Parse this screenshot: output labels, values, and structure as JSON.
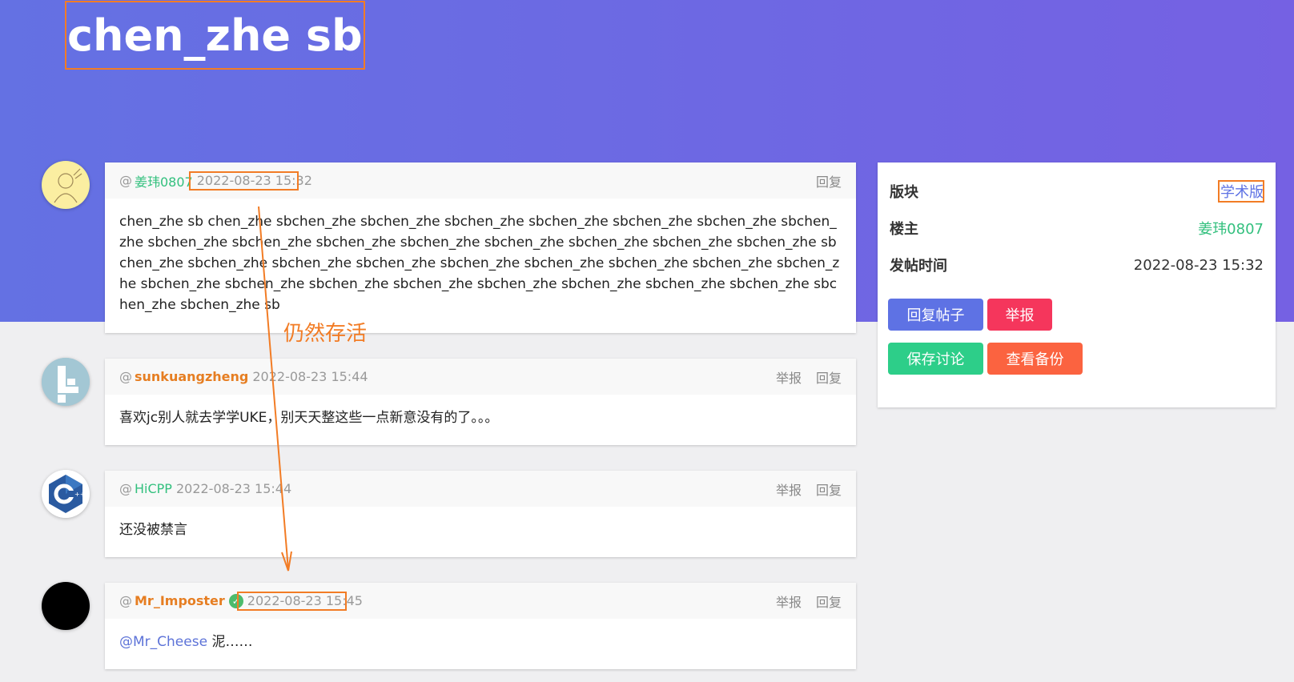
{
  "thread": {
    "title": "chen_zhe sb"
  },
  "posts": [
    {
      "at": "@",
      "user": "姜玮0807",
      "time": "2022-08-23 15:32",
      "actions": [
        "回复"
      ],
      "content": "chen_zhe sb chen_zhe sbchen_zhe sbchen_zhe sbchen_zhe sbchen_zhe sbchen_zhe sbchen_zhe sbchen_zhe sbchen_zhe sbchen_zhe sbchen_zhe sbchen_zhe sbchen_zhe sbchen_zhe sbchen_zhe sbchen_zhe sbchen_zhe sbchen_zhe sbchen_zhe sbchen_zhe sbchen_zhe sbchen_zhe sbchen_zhe sbchen_zhe sbchen_zhe sbchen_zhe sbchen_zhe sbchen_zhe sbchen_zhe sbchen_zhe sbchen_zhe sbchen_zhe sbchen_zhe sbchen_zhe sbchen_zhe sb"
    },
    {
      "at": "@",
      "user": "sunkuangzheng",
      "time": "2022-08-23 15:44",
      "actions": [
        "举报",
        "回复"
      ],
      "content": "喜欢jc别人就去学学UKE，别天天整这些一点新意没有的了。。。"
    },
    {
      "at": "@",
      "user": "HiCPP",
      "time": "2022-08-23 15:44",
      "actions": [
        "举报",
        "回复"
      ],
      "content": "还没被禁言"
    },
    {
      "at": "@",
      "user": "Mr_Imposter",
      "time": "2022-08-23 15:45",
      "actions": [
        "举报",
        "回复"
      ],
      "content_mention": "@Mr_Cheese",
      "content_rest": " 泥……"
    }
  ],
  "sidebar": {
    "forum_label": "版块",
    "forum_value": "学术版",
    "owner_label": "楼主",
    "owner_value": "姜玮0807",
    "time_label": "发帖时间",
    "time_value": "2022-08-23 15:32",
    "buttons": {
      "reply": "回复帖子",
      "report": "举报",
      "save": "保存讨论",
      "backup": "查看备份"
    }
  },
  "annotation": {
    "text": "仍然存活"
  },
  "colors": {
    "hero_start": "#6471e3",
    "hero_end": "#7561e3",
    "highlight": "#f27c25",
    "green_user": "#33c07e",
    "orange_user": "#e67e22",
    "btn_blue": "#5e72e4",
    "btn_red": "#f5365c",
    "btn_green": "#2dce89",
    "btn_orange": "#fb6340"
  }
}
